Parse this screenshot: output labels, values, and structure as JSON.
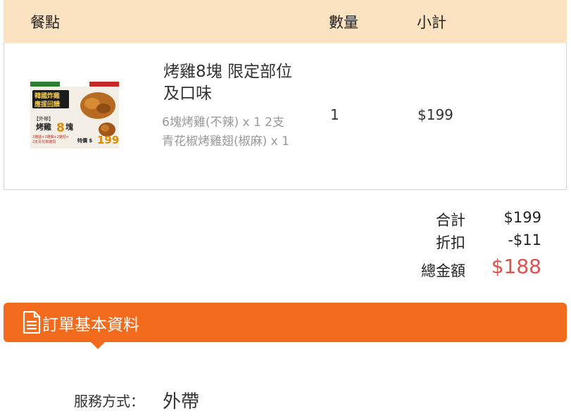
{
  "table_header": {
    "item": "餐點",
    "quantity": "數量",
    "subtotal": "小計"
  },
  "cart_item": {
    "name": "烤雞8塊 限定部位及口味",
    "details": "6塊烤雞(不辣) x 1 2支青花椒烤雞翅(椒麻) x 1",
    "quantity": "1",
    "subtotal": "$199",
    "image": {
      "banner": "韓國炸雞 應援回饋",
      "tag": "【外帶】",
      "title": "烤雞",
      "number": "8",
      "unit": "塊",
      "sub": "2雞腿+2雞胸+2雞翅+2支青花椒雞翅",
      "price_label": "特價 $",
      "price": "199"
    }
  },
  "totals": {
    "sum_label": "合計",
    "sum_value": "$199",
    "discount_label": "折扣",
    "discount_value": "-$11",
    "grand_label": "總金額",
    "grand_value": "$188"
  },
  "section": {
    "title": "訂單基本資料",
    "icon": "document-icon"
  },
  "info": {
    "service_label": "服務方式：",
    "service_value": "外帶"
  },
  "colors": {
    "header_bg": "#fbe3c1",
    "accent": "#f26a1b",
    "grand_total": "#d9534f"
  }
}
